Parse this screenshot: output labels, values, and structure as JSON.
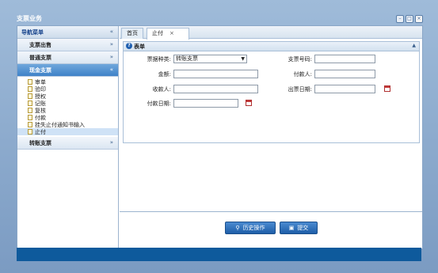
{
  "window": {
    "title": "支票业务"
  },
  "window_buttons": [
    "–",
    "□",
    "×"
  ],
  "sidebar": {
    "header": "导航菜单",
    "groups": [
      {
        "label": "支票出售"
      },
      {
        "label": "普通支票"
      },
      {
        "label": "现金支票"
      },
      {
        "label": "转账支票"
      }
    ],
    "items": [
      "审单",
      "验印",
      "授权",
      "记账",
      "复核",
      "付款",
      "挂失止付通知书输入",
      "止付"
    ]
  },
  "tabs": [
    {
      "label": "首页"
    },
    {
      "label": "止付"
    }
  ],
  "form": {
    "title": "表单",
    "fields": {
      "bill_type_label": "票据种类:",
      "bill_type_value": "转账支票",
      "check_no_label": "支票号码:",
      "amount_label": "金额:",
      "payer_label": "付款人:",
      "payee_label": "收款人:",
      "issue_date_label": "出票日期:",
      "pay_date_label": "付款日期:"
    }
  },
  "buttons": {
    "history": "历史操作",
    "submit": "提交"
  }
}
